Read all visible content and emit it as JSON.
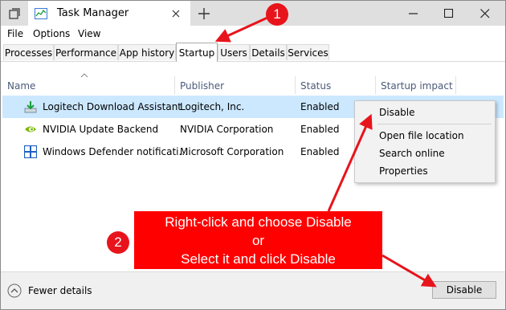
{
  "window": {
    "title": "Task Manager"
  },
  "menu": [
    "File",
    "Options",
    "View"
  ],
  "tabs": [
    "Processes",
    "Performance",
    "App history",
    "Startup",
    "Users",
    "Details",
    "Services"
  ],
  "active_tab": "Startup",
  "columns": {
    "name": "Name",
    "publisher": "Publisher",
    "status": "Status",
    "impact": "Startup impact"
  },
  "rows": [
    {
      "name": "Logitech Download Assistant",
      "publisher": "Logitech, Inc.",
      "status": "Enabled",
      "icon": "logitech-download-icon"
    },
    {
      "name": "NVIDIA Update Backend",
      "publisher": "NVIDIA Corporation",
      "status": "Enabled",
      "icon": "nvidia-icon"
    },
    {
      "name": "Windows Defender notificati...",
      "publisher": "Microsoft Corporation",
      "status": "Enabled",
      "icon": "windows-defender-icon"
    }
  ],
  "context_menu": [
    "Disable",
    "Open file location",
    "Search online",
    "Properties"
  ],
  "footer": {
    "fewer_details": "Fewer details",
    "disable_button": "Disable"
  },
  "annotation": {
    "step1": "1",
    "step2": "2",
    "line1": "Right-click and choose Disable",
    "line2": "or",
    "line3": "Select it and click Disable"
  },
  "colors": {
    "annotation_red": "#ff0000",
    "selection": "#cce8ff",
    "header_text": "#4a5a7a"
  }
}
